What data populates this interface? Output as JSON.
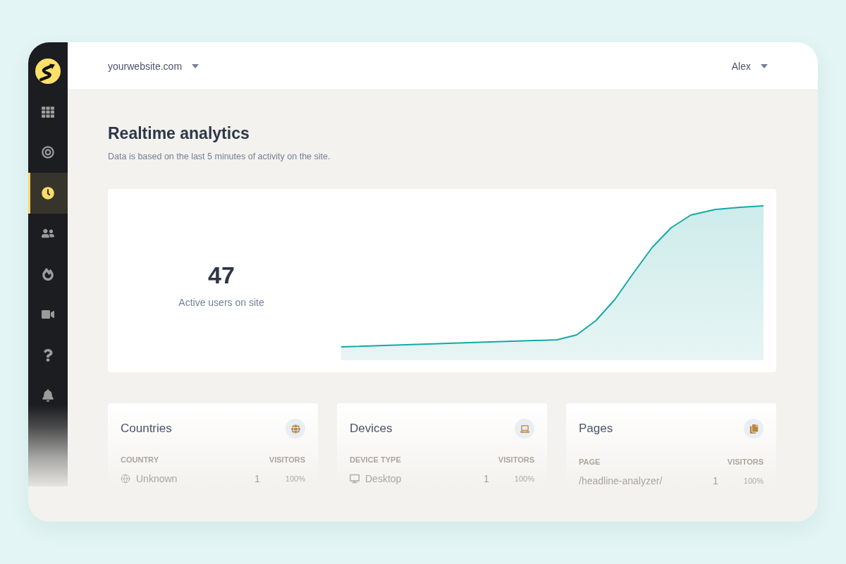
{
  "site_selector": {
    "label": "yourwebsite.com"
  },
  "user_menu": {
    "label": "Alex"
  },
  "sidebar": {
    "items": [
      {
        "selected": false
      },
      {
        "selected": false
      },
      {
        "selected": true
      },
      {
        "selected": false
      },
      {
        "selected": false
      },
      {
        "selected": false
      },
      {
        "selected": false
      },
      {
        "selected": false
      }
    ]
  },
  "page": {
    "title": "Realtime analytics",
    "subtitle": "Data is based on the last 5 minutes of activity on the site."
  },
  "active_users": {
    "count": "47",
    "label": "Active users on site"
  },
  "panels": [
    {
      "kind": "countries",
      "title": "Countries",
      "columns": [
        "COUNTRY",
        "VISITORS"
      ],
      "rows": [
        {
          "name": "Unknown",
          "visitors": "1",
          "share": "100%"
        }
      ]
    },
    {
      "kind": "devices",
      "title": "Devices",
      "columns": [
        "DEVICE TYPE",
        "VISITORS"
      ],
      "rows": [
        {
          "name": "Desktop",
          "visitors": "1",
          "share": "100%"
        }
      ]
    },
    {
      "kind": "pages",
      "title": "Pages",
      "columns": [
        "PAGE",
        "VISITORS"
      ],
      "rows": [
        {
          "name": "/headline-analyzer/",
          "visitors": "1",
          "share": "100%"
        }
      ]
    }
  ]
}
